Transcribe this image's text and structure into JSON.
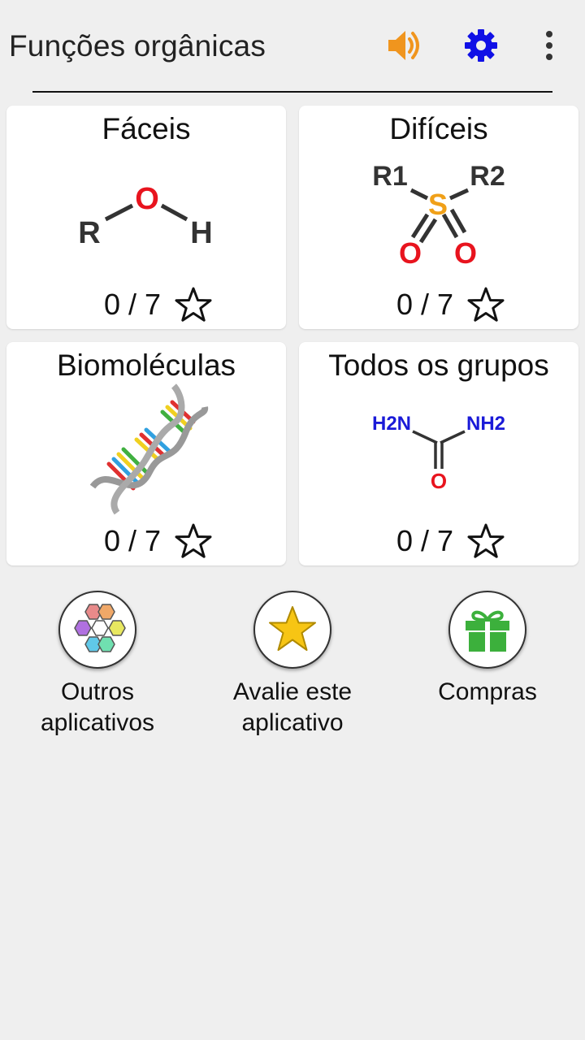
{
  "app": {
    "title": "Funções orgânicas"
  },
  "colors": {
    "sound_icon": "#f0951e",
    "settings_icon": "#1010e6",
    "oxygen_red": "#e8141e",
    "sulfur_orange": "#f0a018",
    "nitrogen_blue": "#1a1ad8",
    "gift_green": "#3cb03c",
    "star_gold": "#f7c514"
  },
  "toolbar": {
    "icons": [
      "sound-icon",
      "settings-gear-icon",
      "more-vert-icon"
    ]
  },
  "cards": [
    {
      "title": "Fáceis",
      "score": "0 / 7",
      "icon": "alcohol-structure",
      "atoms": [
        "R",
        "O",
        "H"
      ]
    },
    {
      "title": "Difíceis",
      "score": "0 / 7",
      "icon": "sulfone-structure",
      "atoms": [
        "R1",
        "R2",
        "S",
        "O",
        "O"
      ]
    },
    {
      "title": "Biomoléculas",
      "score": "0 / 7",
      "icon": "dna-helix"
    },
    {
      "title": "Todos os grupos",
      "score": "0 / 7",
      "icon": "urea-structure",
      "atoms": [
        "H2N",
        "NH2",
        "O"
      ]
    }
  ],
  "bottom_buttons": [
    {
      "line1": "Outros",
      "line2": "aplicativos",
      "icon": "hexagons-icon"
    },
    {
      "line1": "Avalie este",
      "line2": "aplicativo",
      "icon": "star-icon"
    },
    {
      "line1": "Compras",
      "line2": "",
      "icon": "gift-icon"
    }
  ]
}
